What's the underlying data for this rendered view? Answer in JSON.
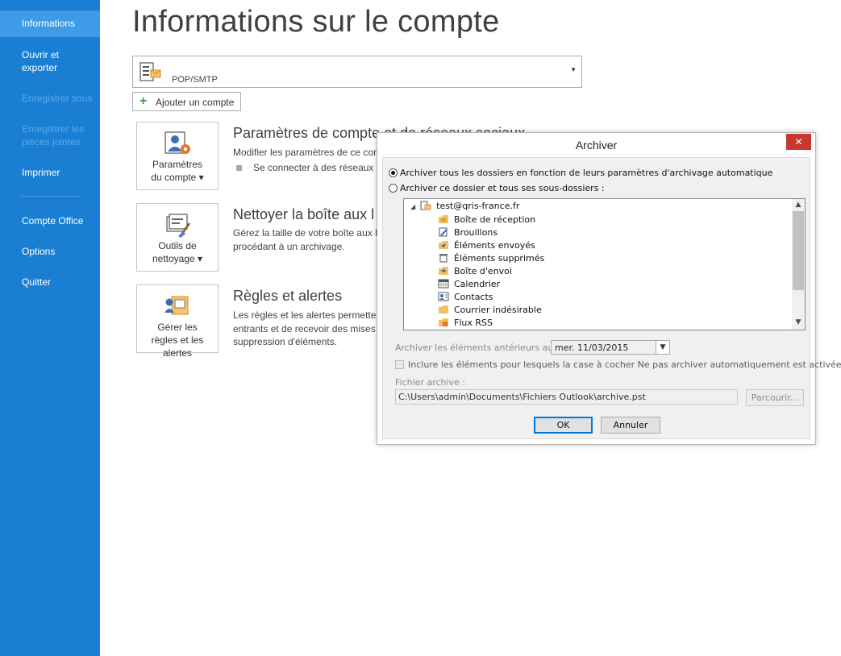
{
  "sidebar": {
    "items": [
      {
        "label": "Informations",
        "state": "active"
      },
      {
        "label": "Ouvrir et exporter",
        "state": "normal"
      },
      {
        "label": "Enregistrer sous",
        "state": "disabled"
      },
      {
        "label": "Enregistrer les pièces jointes",
        "state": "disabled"
      },
      {
        "label": "Imprimer",
        "state": "normal"
      },
      {
        "label": "Compte Office",
        "state": "normal"
      },
      {
        "label": "Options",
        "state": "normal"
      },
      {
        "label": "Quitter",
        "state": "normal"
      }
    ]
  },
  "main": {
    "title": "Informations sur le compte",
    "account_selector": {
      "value": "POP/SMTP"
    },
    "add_account_label": "Ajouter un compte",
    "sections": [
      {
        "tile_label": "Paramètres du compte ▾",
        "title": "Paramètres de compte et de réseaux sociaux",
        "text": "Modifier les paramètres de ce com",
        "bullet": "Se connecter à des réseaux so"
      },
      {
        "tile_label": "Outils de nettoyage ▾",
        "title": "Nettoyer la boîte aux l",
        "text_lines": [
          "Gérez la taille de votre boîte aux le",
          "procédant à un archivage."
        ]
      },
      {
        "tile_label": "Gérer les règles et les alertes",
        "title": "Règles et alertes",
        "text_lines": [
          "Les règles et les alertes permettent",
          "entrants et de recevoir des mises à",
          "suppression d'éléments."
        ]
      }
    ]
  },
  "dialog": {
    "title": "Archiver",
    "close_glyph": "✕",
    "option_auto": "Archiver tous les dossiers en fonction de leurs paramètres d'archivage automatique",
    "option_folder": "Archiver ce dossier et tous ses sous-dossiers :",
    "tree_root": "test@qris-france.fr",
    "folders": [
      {
        "label": "Boîte de réception",
        "icon": "inbox-icon"
      },
      {
        "label": "Brouillons",
        "icon": "drafts-icon"
      },
      {
        "label": "Éléments envoyés",
        "icon": "sent-icon"
      },
      {
        "label": "Éléments supprimés",
        "icon": "trash-icon"
      },
      {
        "label": "Boîte d'envoi",
        "icon": "outbox-icon"
      },
      {
        "label": "Calendrier",
        "icon": "calendar-icon"
      },
      {
        "label": "Contacts",
        "icon": "contacts-icon"
      },
      {
        "label": "Courrier indésirable",
        "icon": "junk-folder-icon"
      },
      {
        "label": "Flux RSS",
        "icon": "rss-icon"
      }
    ],
    "older_than_label": "Archiver les éléments antérieurs au :",
    "older_than_value": "mer. 11/03/2015",
    "include_label": "Inclure les éléments pour lesquels la case à cocher Ne pas archiver automatiquement est activée",
    "archive_file_label": "Fichier archive :",
    "archive_file_value": "C:\\Users\\admin\\Documents\\Fichiers Outlook\\archive.pst",
    "browse_label": "Parcourir...",
    "ok_label": "OK",
    "cancel_label": "Annuler"
  },
  "colors": {
    "sidebar": "#1a7fd3",
    "sidebar_active": "#3d9be8",
    "close_button": "#c7372f",
    "default_button_border": "#0078d7"
  }
}
